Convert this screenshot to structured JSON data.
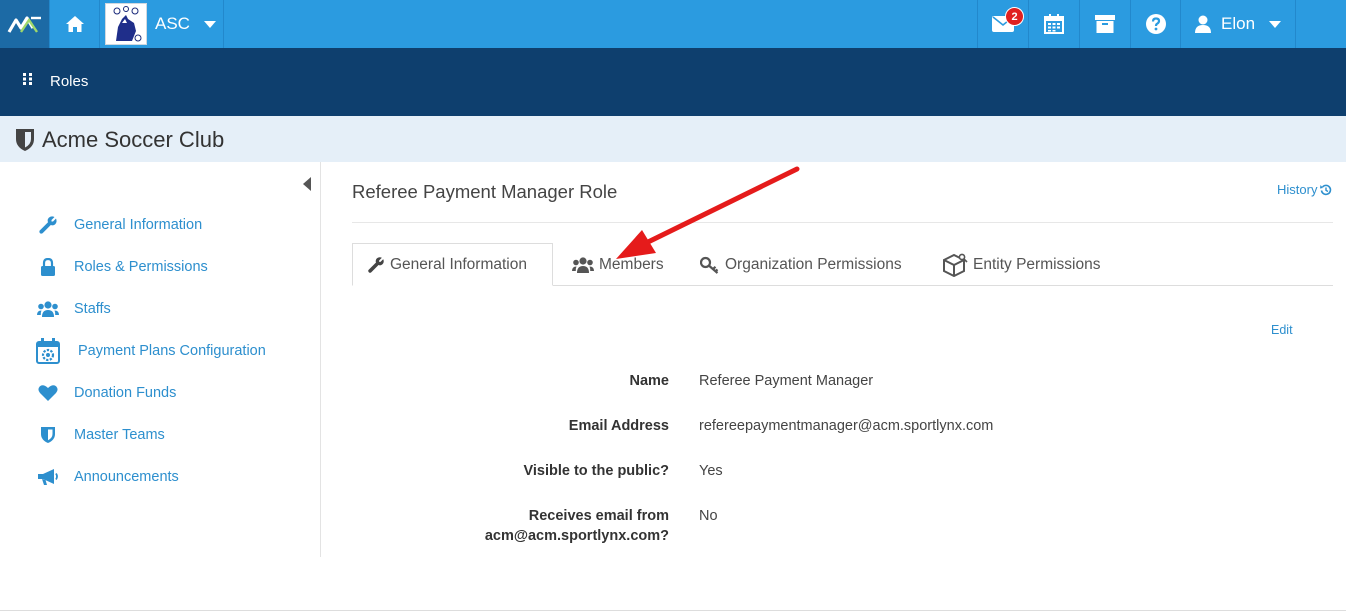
{
  "topbar": {
    "club_abbr": "ASC",
    "mail_badge": "2",
    "user_name": "Elon"
  },
  "breadcrumb": {
    "label": "Roles"
  },
  "org": {
    "name": "Acme Soccer Club"
  },
  "sidebar": {
    "items": [
      {
        "label": "General Information",
        "icon": "wrench-icon"
      },
      {
        "label": "Roles & Permissions",
        "icon": "lock-icon"
      },
      {
        "label": "Staffs",
        "icon": "users-icon"
      },
      {
        "label": "Payment Plans Configuration",
        "icon": "calendar-gear-icon"
      },
      {
        "label": "Donation Funds",
        "icon": "heart-icon"
      },
      {
        "label": "Master Teams",
        "icon": "shield-icon"
      },
      {
        "label": "Announcements",
        "icon": "megaphone-icon"
      }
    ]
  },
  "main": {
    "title": "Referee Payment Manager Role",
    "history_label": "History",
    "edit_label": "Edit",
    "tabs": [
      {
        "label": "General Information",
        "active": true
      },
      {
        "label": "Members",
        "active": false
      },
      {
        "label": "Organization Permissions",
        "active": false
      },
      {
        "label": "Entity Permissions",
        "active": false
      }
    ],
    "fields": [
      {
        "label": "Name",
        "value": "Referee Payment Manager"
      },
      {
        "label": "Email Address",
        "value": "refereepaymentmanager@acm.sportlynx.com"
      },
      {
        "label": "Visible to the public?",
        "value": "Yes"
      },
      {
        "label": "Receives email from acm@acm.sportlynx.com?",
        "value": "No"
      }
    ]
  },
  "colors": {
    "topbar": "#2b9be0",
    "rolesbar": "#0e3f6e",
    "orgbar": "#e5eff8",
    "link": "#2d8fce",
    "annotation_arrow": "#e51b1b"
  }
}
